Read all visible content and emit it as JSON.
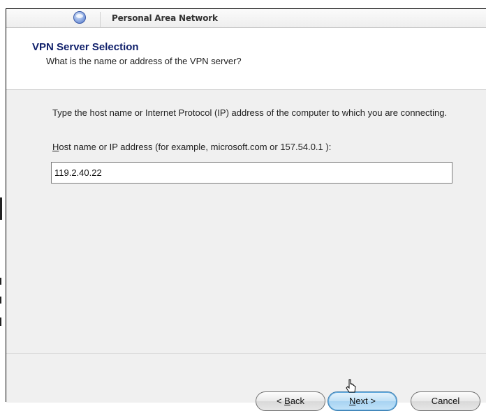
{
  "window": {
    "tab_title": "Personal Area Network"
  },
  "header": {
    "title": "VPN Server Selection",
    "subtitle": "What is the name or address of the VPN server?"
  },
  "body": {
    "description": "Type the host name or Internet Protocol (IP) address of the computer to which you are connecting.",
    "field_label_mnemonic": "H",
    "field_label_rest": "ost name or IP address (for example, microsoft.com or 157.54.0.1 ):",
    "host_value": "119.2.40.22"
  },
  "footer": {
    "back_label_prefix": "< ",
    "back_label_mnemonic": "B",
    "back_label_rest": "ack",
    "next_label_mnemonic": "N",
    "next_label_rest": "ext >",
    "cancel_label": "Cancel"
  },
  "icons": {
    "window_orb": "windows-orb-icon",
    "cursor": "mouse-pointer-icon"
  },
  "colors": {
    "title_color": "#10206b",
    "next_button_accent": "#3c7fb1"
  }
}
